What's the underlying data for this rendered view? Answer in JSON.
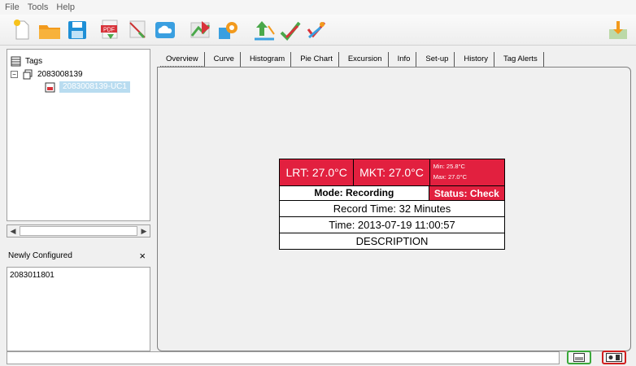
{
  "menu": [
    "File",
    "Tools",
    "Help"
  ],
  "toolbar": {
    "buttons": [
      {
        "icon": "new-file-icon"
      },
      {
        "icon": "open-folder-icon"
      },
      {
        "icon": "save-icon"
      },
      {
        "icon": "pdf-export-icon",
        "text": "PDF"
      },
      {
        "icon": "csv-export-icon"
      },
      {
        "icon": "cloud-icon"
      },
      {
        "icon": "chart-icon"
      },
      {
        "icon": "settings-gear-icon"
      },
      {
        "icon": "upload-icon"
      },
      {
        "icon": "check-icon"
      },
      {
        "icon": "download-icon"
      },
      {
        "icon": "exit-icon"
      }
    ]
  },
  "tree": {
    "root_label": "Tags",
    "expander": "−",
    "group_label": "2083008139",
    "selected_label": "2083008139-UC1"
  },
  "scroll": {
    "left": "◀",
    "right": "▶"
  },
  "newly_configured": {
    "title": "Newly Configured",
    "close": "×",
    "items": [
      "2083011801"
    ]
  },
  "tabs": [
    "Overview",
    "Curve",
    "Histogram",
    "Pie Chart",
    "Excursion",
    "Info",
    "Set-up",
    "History",
    "Tag Alerts"
  ],
  "summary": {
    "lrt": "LRT: 27.0°C",
    "mkt": "MKT: 27.0°C",
    "min": "Min:  25.8°C",
    "max": "Max:  27.0°C",
    "mode": "Mode: Recording",
    "status": "Status: Check",
    "record_time": "Record Time: 32 Minutes",
    "time": "Time: 2013-07-19 11:00:57",
    "description": "DESCRIPTION"
  },
  "colors": {
    "alert_red": "#e2203f",
    "selected": "#b9dcf0",
    "green_btn": "#3aa83a",
    "red_btn": "#d02020"
  }
}
